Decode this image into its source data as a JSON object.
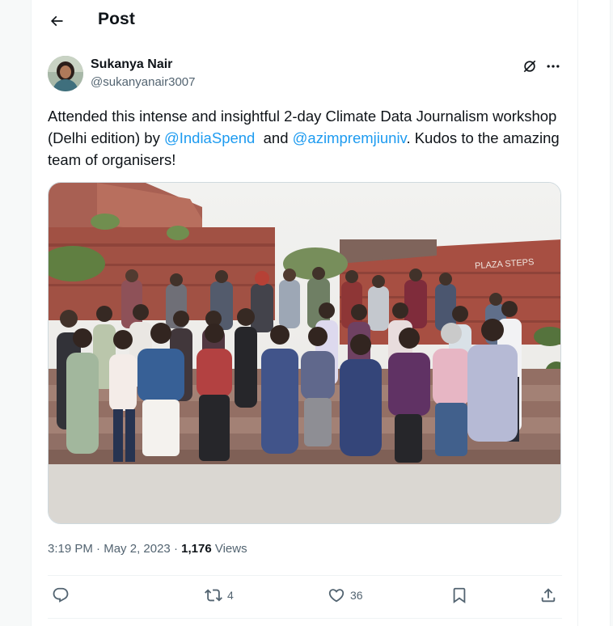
{
  "header": {
    "title": "Post",
    "back_icon": "arrow-left-icon"
  },
  "author": {
    "name": "Sukanya Nair",
    "handle": "@sukanyanair3007"
  },
  "tweet": {
    "part1": "Attended this intense and insightful 2-day Climate Data Journalism workshop (Delhi edition) by ",
    "mention1": "@IndiaSpend",
    "part2": "  and ",
    "mention2": "@azimpremjiuniv",
    "part3": ". Kudos to the amazing team of organisers!"
  },
  "photo": {
    "sign_text": "PLAZA STEPS"
  },
  "meta": {
    "time": "3:19 PM",
    "sep1": " · ",
    "date": "May 2, 2023",
    "sep2": " · ",
    "views_count": "1,176",
    "views_label": " Views"
  },
  "actions": {
    "reply_icon": "reply-icon",
    "repost_count": "4",
    "like_count": "36",
    "bookmark_icon": "bookmark-icon",
    "share_icon": "share-icon"
  },
  "colors": {
    "accent": "#1d9bf0",
    "text": "#0f1419",
    "muted": "#536471",
    "border": "#eff3f4"
  }
}
